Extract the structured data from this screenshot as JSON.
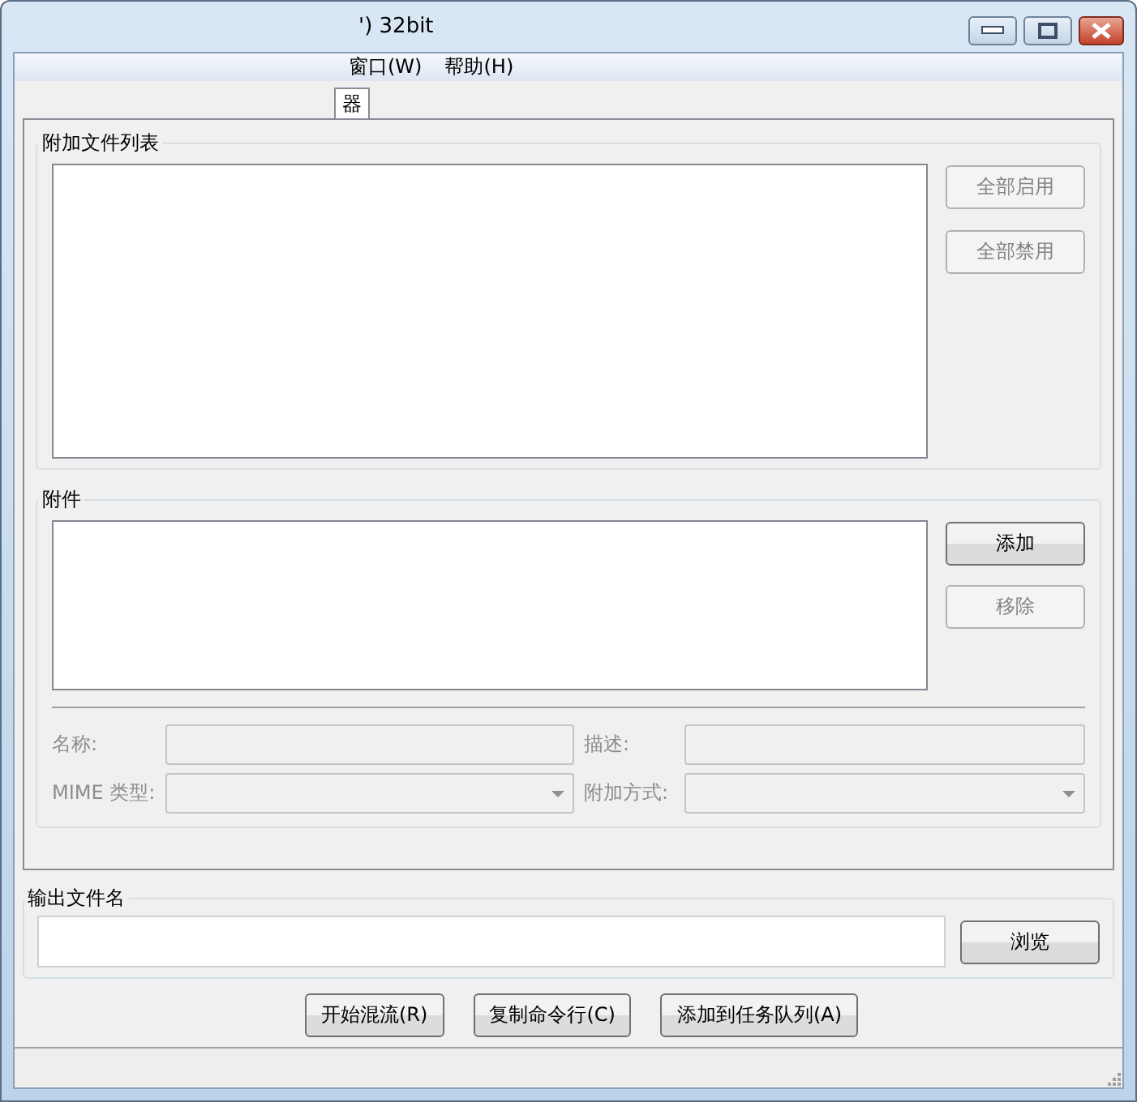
{
  "window": {
    "title": "') 32bit"
  },
  "menu": [
    {
      "label": "窗口(W)"
    },
    {
      "label": "帮助(H)"
    }
  ],
  "tabs": [
    {
      "label": "器",
      "selected": true
    }
  ],
  "attach_list": {
    "title": "附加文件列表",
    "buttons": [
      {
        "label": "全部启用",
        "disabled": true
      },
      {
        "label": "全部禁用",
        "disabled": true
      }
    ]
  },
  "attachments": {
    "title": "附件",
    "buttons": [
      {
        "label": "添加",
        "disabled": false
      },
      {
        "label": "移除",
        "disabled": true
      }
    ],
    "fields": [
      {
        "kind": "text",
        "label": "名称:",
        "disabled": true
      },
      {
        "kind": "text",
        "label": "描述:",
        "disabled": true
      },
      {
        "kind": "dropdown",
        "label": "MIME 类型:",
        "disabled": true
      },
      {
        "kind": "dropdown",
        "label": "附加方式:",
        "disabled": true
      }
    ]
  },
  "output": {
    "title": "输出文件名",
    "browse": "浏览"
  },
  "actions": [
    {
      "label": "开始混流(R)"
    },
    {
      "label": "复制命令行(C)"
    },
    {
      "label": "添加到任务队列(A)"
    }
  ]
}
